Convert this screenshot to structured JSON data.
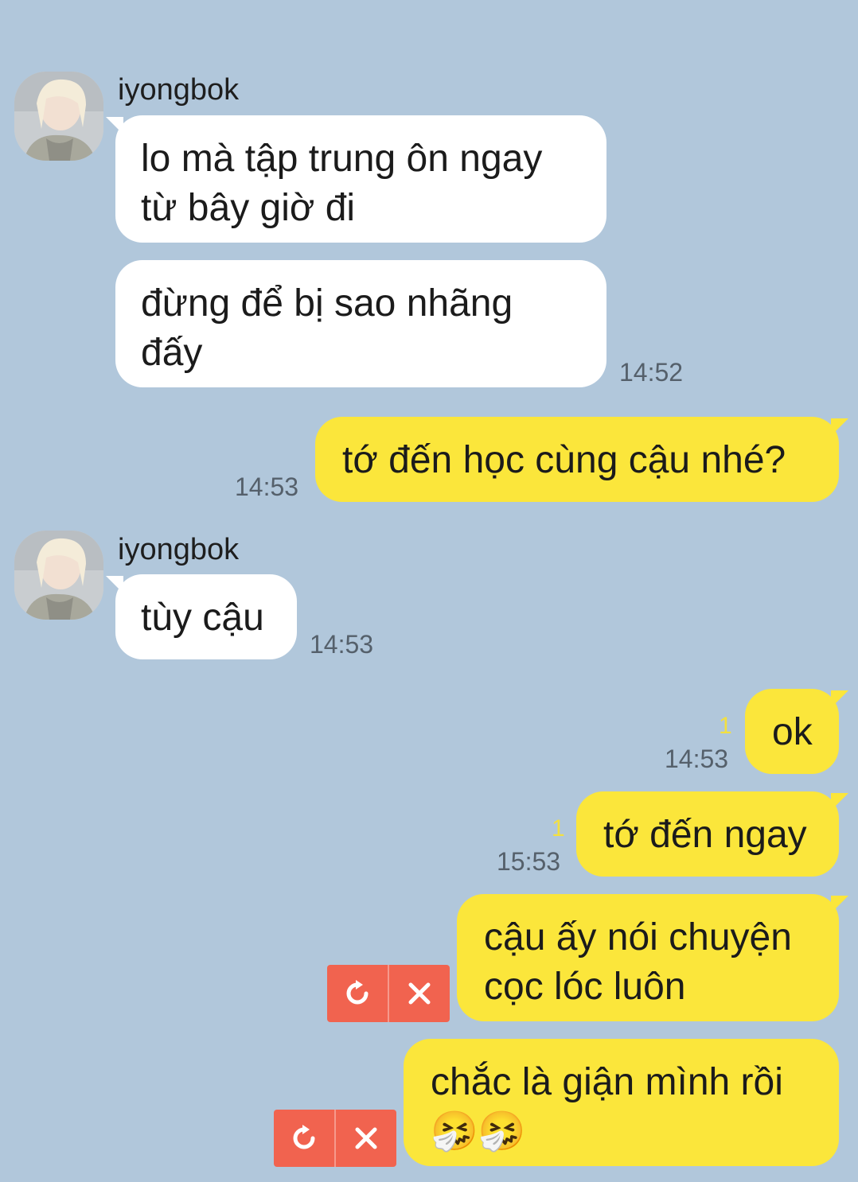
{
  "contact": {
    "name": "iyongbok"
  },
  "messages": [
    {
      "id": "m1",
      "side": "in",
      "text_line1": "lo mà tập trung ôn ngay",
      "text_line2": "từ bây giờ đi"
    },
    {
      "id": "m2",
      "side": "in",
      "text_line1": "đừng để bị sao nhãng",
      "text_line2": "đấy",
      "time": "14:52"
    },
    {
      "id": "m3",
      "side": "out",
      "text": "tớ đến học cùng cậu nhé?",
      "time": "14:53"
    },
    {
      "id": "m4",
      "side": "in",
      "text": "tùy cậu",
      "time": "14:53"
    },
    {
      "id": "m5",
      "side": "out",
      "text": "ok",
      "time": "14:53",
      "unread": "1"
    },
    {
      "id": "m6",
      "side": "out",
      "text": "tớ đến ngay",
      "time": "15:53",
      "unread": "1"
    },
    {
      "id": "m7",
      "side": "out",
      "text_line1": "cậu ấy nói chuyện",
      "text_line2": "cọc lóc luôn",
      "status": "failed"
    },
    {
      "id": "m8",
      "side": "out",
      "text_line1": "chắc là giận mình rồi",
      "text_line2": "🤧🤧",
      "status": "failed"
    }
  ],
  "failed_actions": {
    "retry_icon": "retry-icon",
    "delete_icon": "close-icon"
  },
  "colors": {
    "background": "#b1c7db",
    "outgoing": "#fbe63b",
    "incoming": "#ffffff",
    "failed": "#f1634f"
  }
}
